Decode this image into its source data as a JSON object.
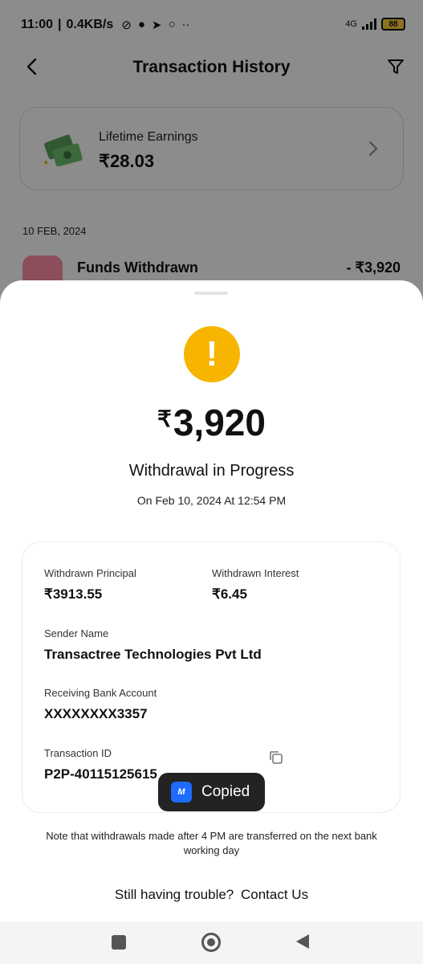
{
  "status_bar": {
    "time": "11:00",
    "speed": "0.4KB/s",
    "network": "4G",
    "battery": "88"
  },
  "header": {
    "title": "Transaction History"
  },
  "earnings": {
    "label": "Lifetime Earnings",
    "value": "₹28.03"
  },
  "history": {
    "date": "10 FEB, 2024",
    "item_title": "Funds Withdrawn",
    "item_amount": "- ₹3,920"
  },
  "sheet": {
    "currency": "₹",
    "amount": "3,920",
    "status": "Withdrawal in Progress",
    "date": "On Feb 10, 2024 At 12:54 PM",
    "fields": {
      "principal_label": "Withdrawn Principal",
      "principal_value": "₹3913.55",
      "interest_label": "Withdrawn Interest",
      "interest_value": "₹6.45",
      "sender_label": "Sender Name",
      "sender_value": "Transactree Technologies Pvt Ltd",
      "bank_label": "Receiving Bank Account",
      "bank_value": "XXXXXXXX3357",
      "txn_label": "Transaction ID",
      "txn_value": "P2P-40115125615"
    },
    "toast": {
      "logo": "M",
      "text": "Copied"
    },
    "note": "Note that withdrawals made after 4 PM are transferred on the next bank working day",
    "help_question": "Still having trouble?",
    "help_link": "Contact Us"
  },
  "colors": {
    "warning": "#f7b500",
    "toast_bg": "#232323",
    "toast_logo": "#1e6bff"
  }
}
